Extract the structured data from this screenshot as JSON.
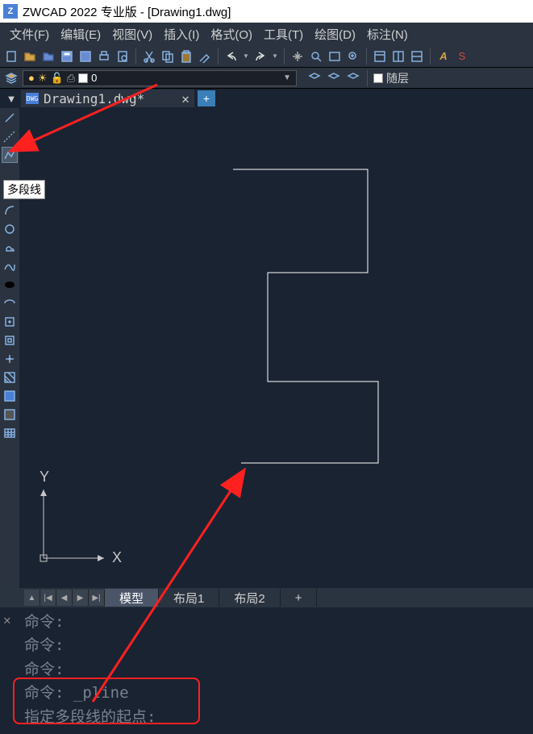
{
  "window": {
    "title": "ZWCAD 2022 专业版 - [Drawing1.dwg]",
    "logo_letter": "Z"
  },
  "menu": {
    "file": "文件(F)",
    "edit": "编辑(E)",
    "view": "视图(V)",
    "insert": "插入(I)",
    "format": "格式(O)",
    "tools": "工具(T)",
    "draw": "绘图(D)",
    "annotate": "标注(N)"
  },
  "layer": {
    "current": "0",
    "follow": "随层"
  },
  "tabs": {
    "file_name": "Drawing1.dwg*",
    "close": "✕",
    "new": "+",
    "dropdown": "▼"
  },
  "left_tools": {
    "line": "line-tool",
    "construction_line": "construction-line-tool",
    "polyline": "polyline-tool",
    "polygon": "polygon-tool",
    "rectangle": "rectangle-tool",
    "arc": "arc-tool",
    "circle": "circle-tool",
    "cloud": "cloud-tool",
    "spline": "spline-tool",
    "ellipse": "ellipse-tool",
    "ellipse_arc": "ellipse-arc-tool",
    "block": "block-tool",
    "insert_block": "insert-block-tool",
    "hatch": "hatch-tool",
    "gradient": "gradient-tool",
    "region": "region-tool",
    "table": "table-tool",
    "tooltip_text": "多段线"
  },
  "axes": {
    "x": "X",
    "y": "Y"
  },
  "layout_tabs": {
    "model": "模型",
    "layout1": "布局1",
    "layout2": "布局2",
    "add": "+"
  },
  "command": {
    "prompt": "命令:",
    "pline_cmd": "命令: _pline",
    "prompt_start": "指定多段线的起点:"
  },
  "colors": {
    "accent": "#4a7fd8",
    "highlight": "#ff2020"
  }
}
